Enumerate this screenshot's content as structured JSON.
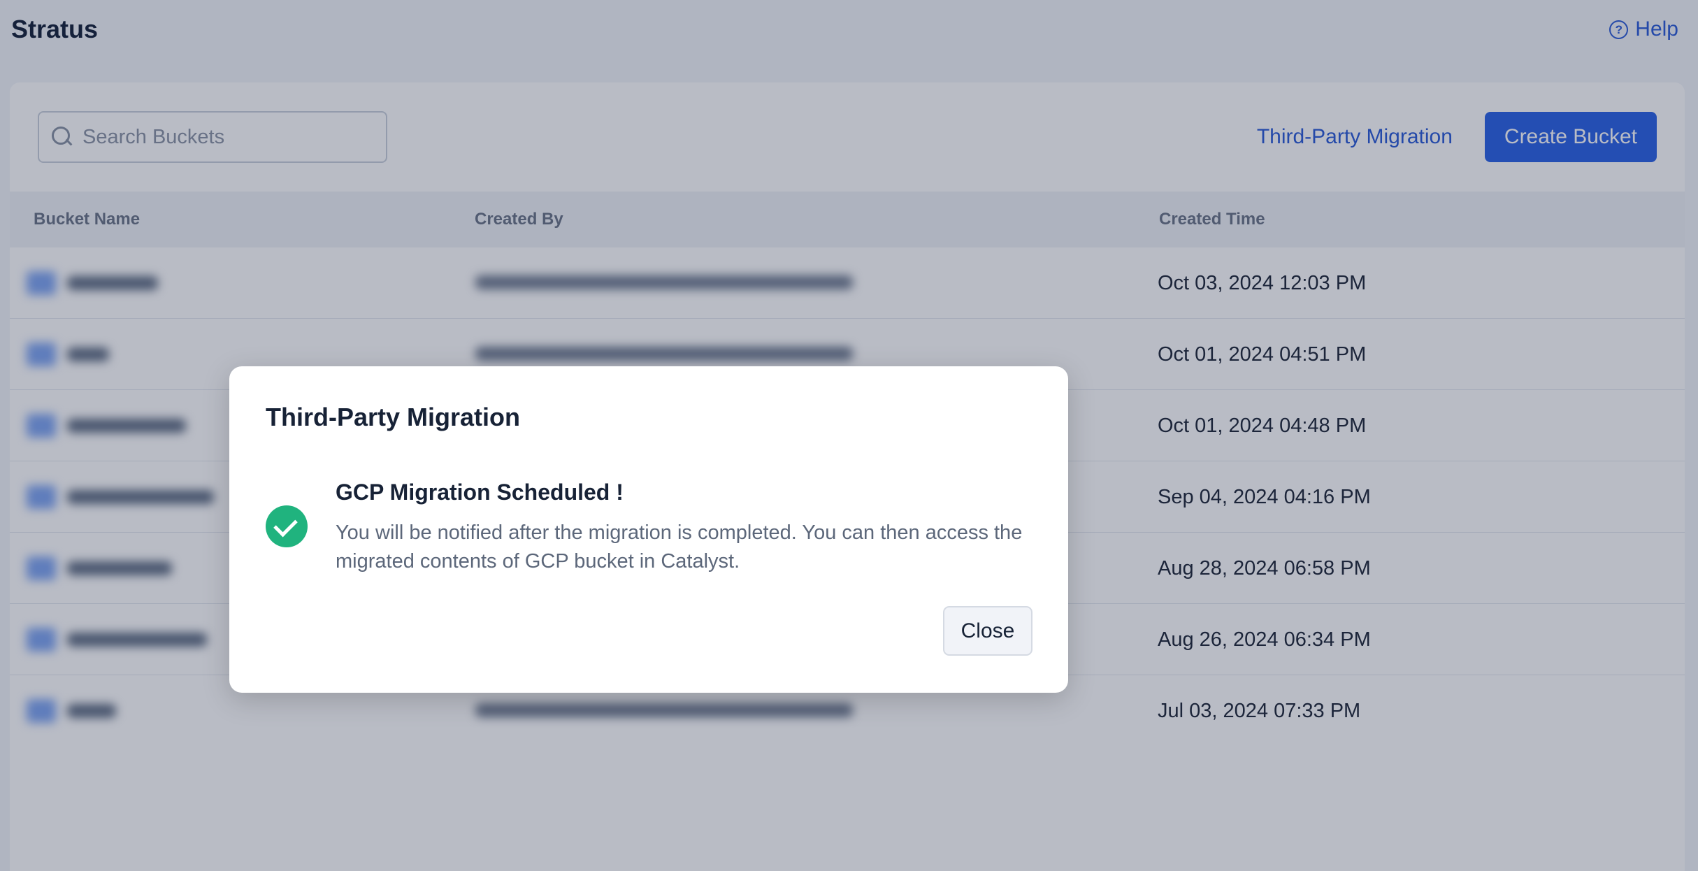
{
  "app": {
    "title": "Stratus",
    "help_label": "Help"
  },
  "toolbar": {
    "search_placeholder": "Search Buckets",
    "migration_label": "Third-Party Migration",
    "create_label": "Create Bucket"
  },
  "table": {
    "headers": {
      "name": "Bucket Name",
      "created_by": "Created By",
      "created_time": "Created Time"
    },
    "rows": [
      {
        "created_time": "Oct 03, 2024 12:03 PM"
      },
      {
        "created_time": "Oct 01, 2024 04:51 PM"
      },
      {
        "created_time": "Oct 01, 2024 04:48 PM"
      },
      {
        "created_time": "Sep 04, 2024 04:16 PM"
      },
      {
        "created_time": "Aug 28, 2024 06:58 PM"
      },
      {
        "created_time": "Aug 26, 2024 06:34 PM"
      },
      {
        "created_time": "Jul 03, 2024 07:33 PM"
      }
    ]
  },
  "modal": {
    "title": "Third-Party Migration",
    "heading": "GCP Migration Scheduled !",
    "body": "You will be notified after the migration is completed. You can then access the migrated contents of GCP bucket in Catalyst.",
    "close_label": "Close",
    "icon": "check-circle-icon"
  },
  "colors": {
    "accent": "#2a62e6",
    "link": "#2a5bd7",
    "success": "#20b37e"
  }
}
